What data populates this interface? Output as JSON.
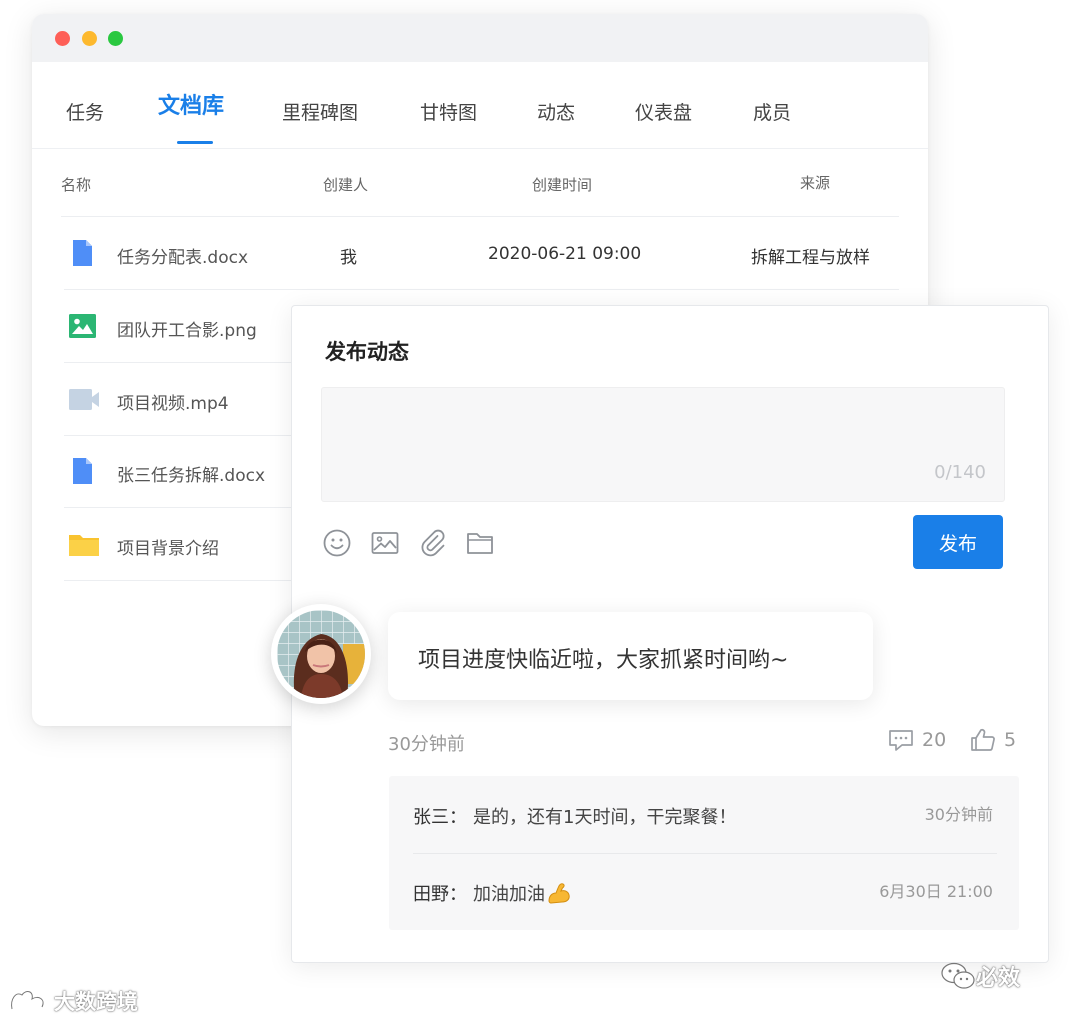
{
  "tabs": [
    {
      "label": "任务"
    },
    {
      "label": "文档库",
      "active": true
    },
    {
      "label": "里程碑图"
    },
    {
      "label": "甘特图"
    },
    {
      "label": "动态"
    },
    {
      "label": "仪表盘"
    },
    {
      "label": "成员"
    }
  ],
  "table": {
    "headers": {
      "name": "名称",
      "creator": "创建人",
      "created_time": "创建时间",
      "source": "来源"
    },
    "rows": [
      {
        "name": "任务分配表.docx",
        "icon": "doc-icon",
        "creator": "我",
        "time": "2020-06-21 09:00",
        "source": "拆解工程与放样"
      },
      {
        "name": "团队开工合影.png",
        "icon": "image-icon"
      },
      {
        "name": "项目视频.mp4",
        "icon": "video-icon"
      },
      {
        "name": "张三任务拆解.docx",
        "icon": "doc-icon"
      },
      {
        "name": "项目背景介绍",
        "icon": "folder-icon"
      }
    ]
  },
  "publish": {
    "title": "发布动态",
    "counter": "0/140",
    "tools": [
      "emoji-icon",
      "image-icon",
      "attachment-icon",
      "folder-icon"
    ],
    "button": "发布"
  },
  "post": {
    "text": "项目进度快临近啦，大家抓紧时间哟~",
    "time": "30分钟前",
    "comments": "20",
    "likes": "5",
    "replies": [
      {
        "name": "张三：",
        "text": "是的，还有1天时间，干完聚餐！",
        "time": "30分钟前"
      },
      {
        "name": "田野：",
        "text": "加油加油",
        "emoji": "flexed-biceps-icon",
        "time": "6月30日 21:00"
      }
    ]
  },
  "watermarks": {
    "left": "大数跨境",
    "right": "必效"
  },
  "colors": {
    "accent": "#1a7fe8",
    "doc": "#4f8ef7",
    "image": "#2bb673",
    "video": "#c5d3e3",
    "folder": "#f9c32f"
  }
}
